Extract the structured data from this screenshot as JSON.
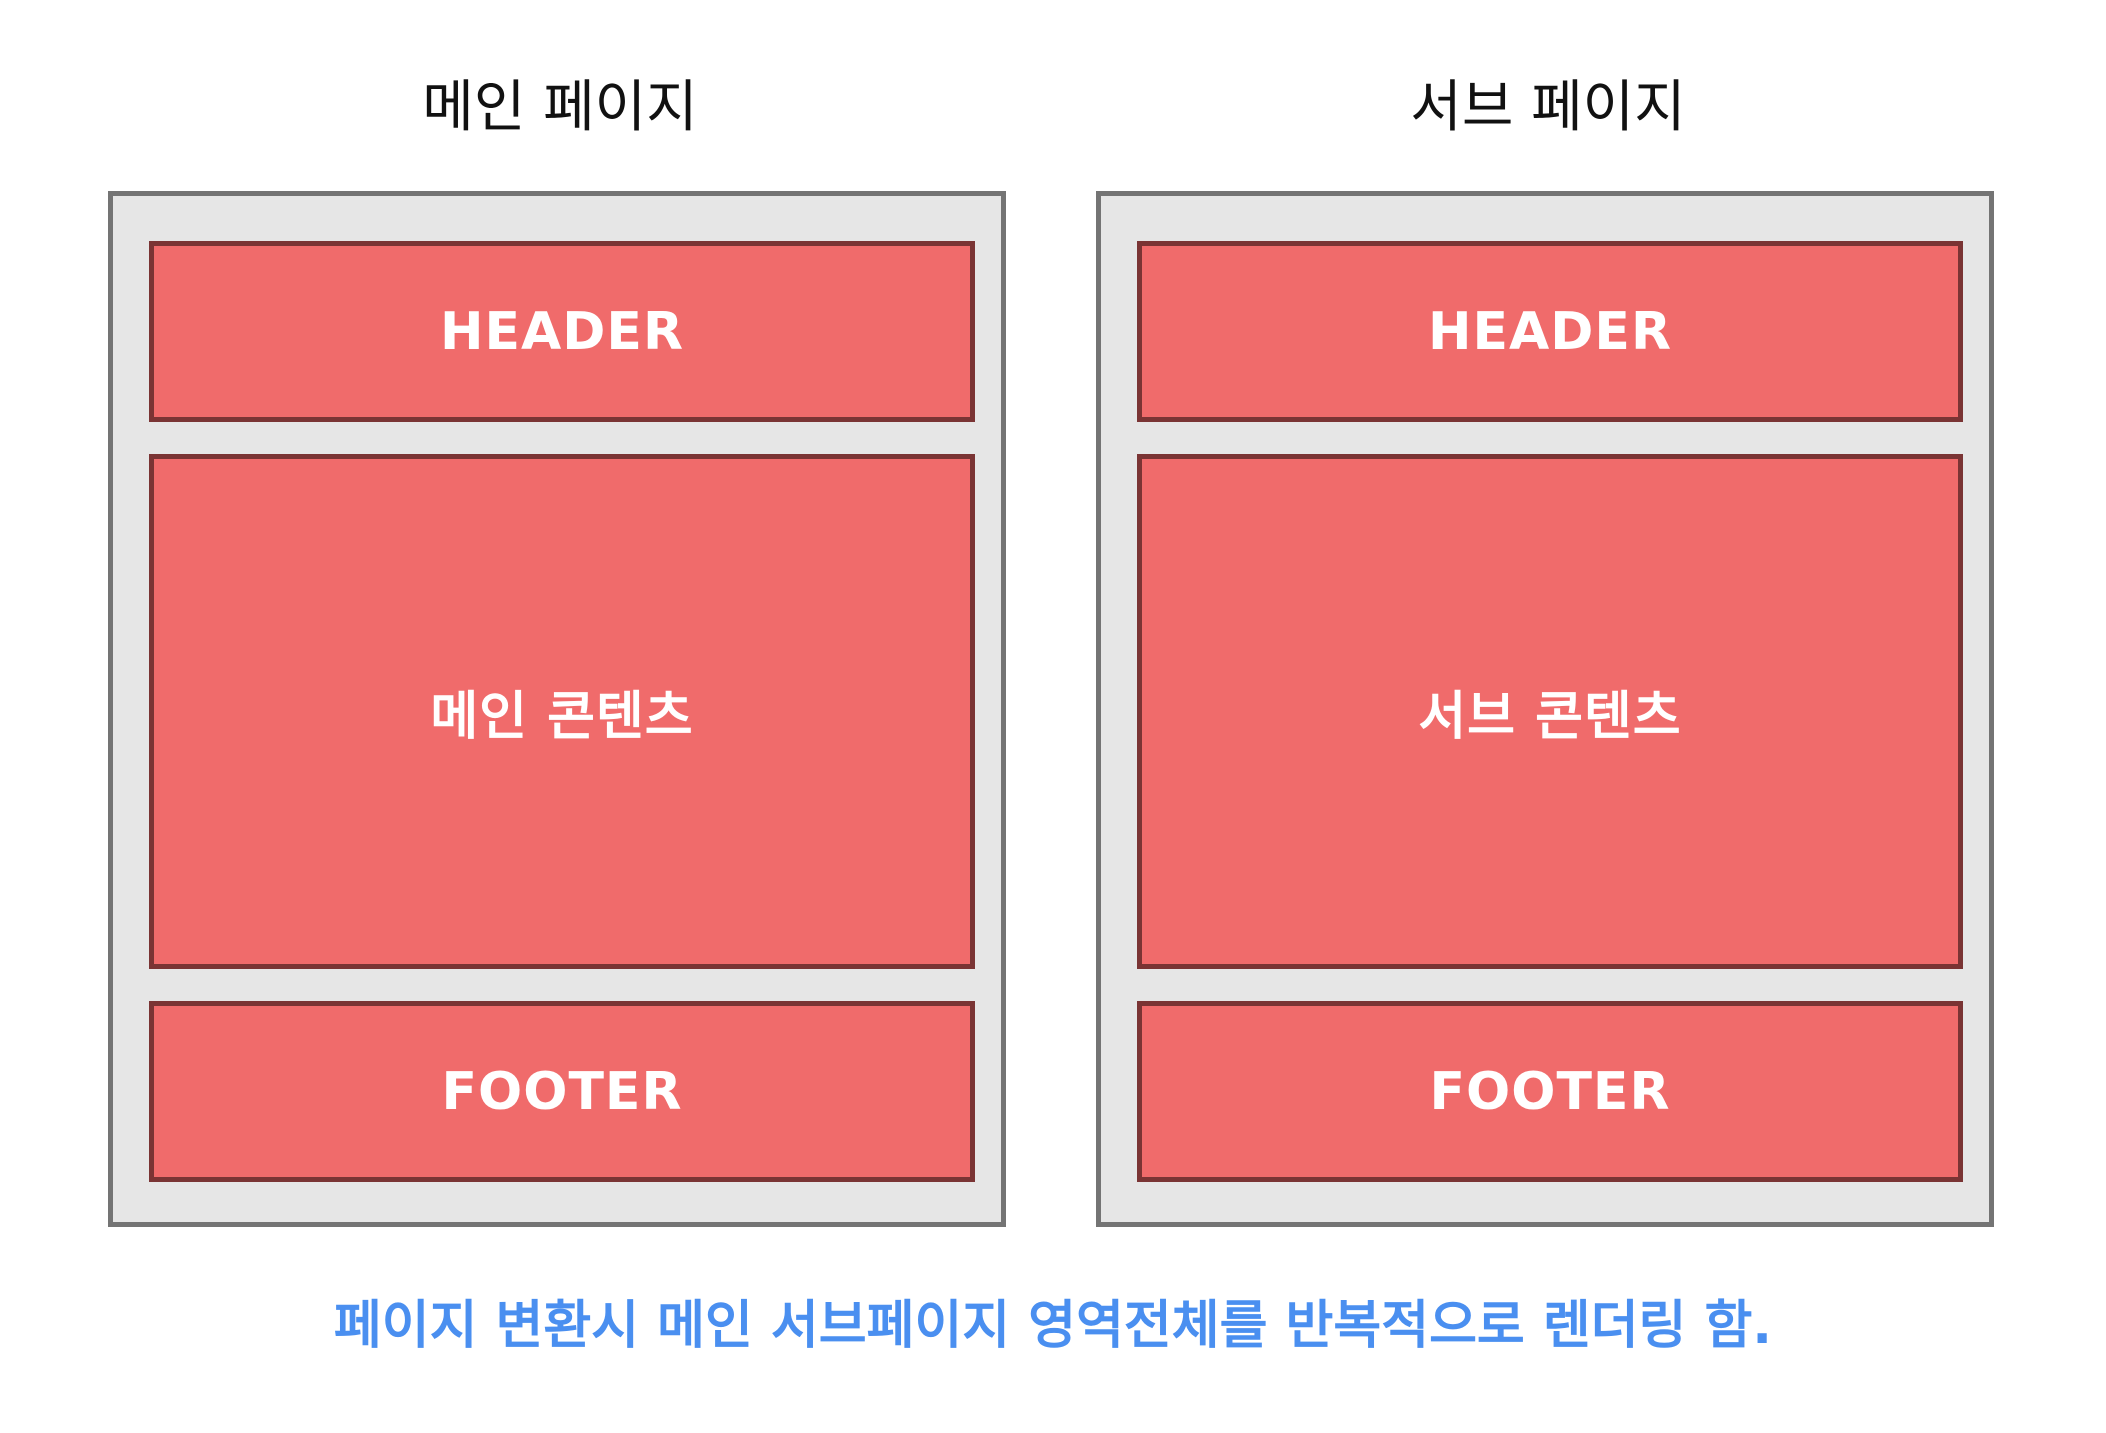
{
  "main_page": {
    "title": "메인 페이지",
    "header": "HEADER",
    "content": "메인 콘텐츠",
    "footer": "FOOTER"
  },
  "sub_page": {
    "title": "서브 페이지",
    "header": "HEADER",
    "content": "서브 콘텐츠",
    "footer": "FOOTER"
  },
  "caption": "페이지 변환시 메인 서브페이지 영역전체를 반복적으로 렌더링 함.",
  "colors": {
    "frame_bg": "#e6e6e6",
    "frame_border": "#747474",
    "block_fill": "#f06b6b",
    "block_border": "#7a3434",
    "caption_text": "#4a8ff0"
  }
}
